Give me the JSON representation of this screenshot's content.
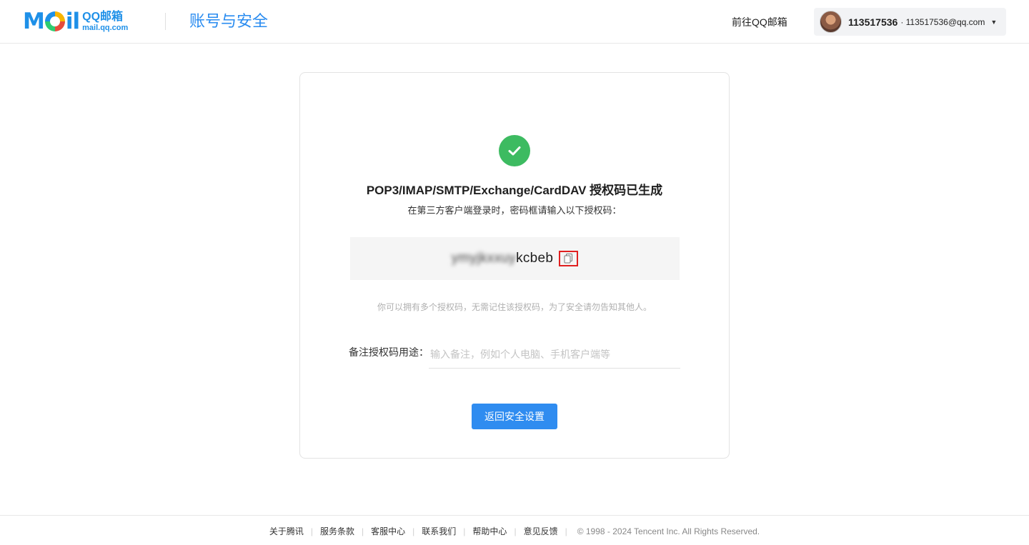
{
  "header": {
    "logo_mail": "Mail",
    "logo_brand": "QQ邮箱",
    "logo_domain": "mail.qq.com",
    "title": "账号与安全",
    "goto_label": "前往QQ邮箱",
    "account": {
      "name": "113517536",
      "email": "· 113517536@qq.com"
    }
  },
  "card": {
    "title": "POP3/IMAP/SMTP/Exchange/CardDAV 授权码已生成",
    "subtitle": "在第三方客户端登录时，密码框请输入以下授权码：",
    "code_visible_suffix": "kcbeb",
    "code_blurred_prefix": "ymyjkxxuy",
    "hint": "你可以拥有多个授权码，无需记住该授权码，为了安全请勿告知其他人。",
    "note_label": "备注授权码用途：",
    "note_placeholder": "输入备注，例如个人电脑、手机客户端等",
    "note_value": "",
    "back_button": "返回安全设置"
  },
  "footer": {
    "links": [
      "关于腾讯",
      "服务条款",
      "客服中心",
      "联系我们",
      "帮助中心",
      "意见反馈"
    ],
    "copyright": "© 1998 - 2024 Tencent Inc. All Rights Reserved."
  },
  "colors": {
    "accent": "#2f8cf0",
    "success": "#3dbb61",
    "highlight": "#e02020"
  },
  "icons": [
    "check-icon",
    "copy-icon",
    "caret-down-icon"
  ]
}
